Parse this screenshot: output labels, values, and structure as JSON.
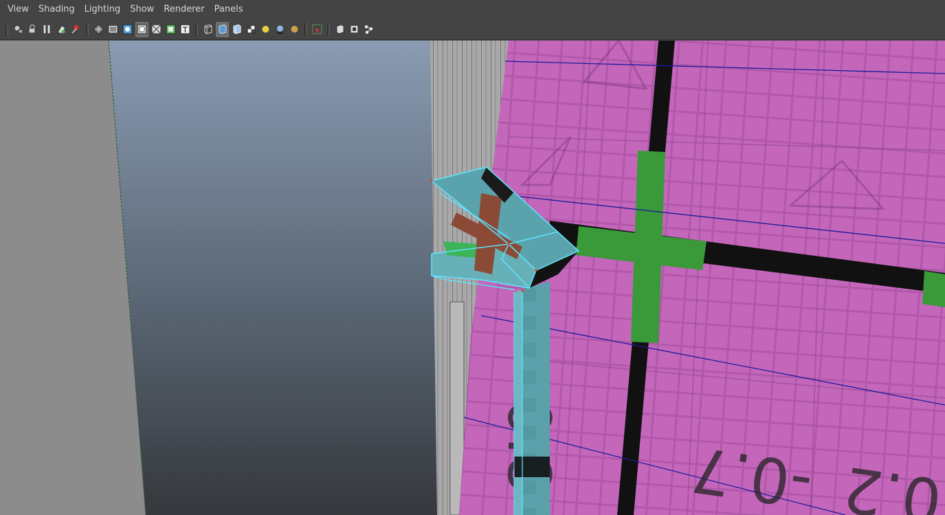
{
  "menu": {
    "items": [
      "View",
      "Shading",
      "Lighting",
      "Show",
      "Renderer",
      "Panels"
    ]
  },
  "toolbar": {
    "groups": [
      [
        {
          "icon": "select-camera-icon"
        },
        {
          "icon": "lock-camera-icon"
        },
        {
          "icon": "camera-attributes-icon"
        },
        {
          "icon": "bookmark-icon"
        },
        {
          "icon": "image-plane-icon"
        }
      ],
      [
        {
          "icon": "grid-icon"
        },
        {
          "icon": "film-gate-icon"
        },
        {
          "icon": "resolution-gate-icon"
        },
        {
          "icon": "gate-mask-icon",
          "active": true
        },
        {
          "icon": "field-chart-icon"
        },
        {
          "icon": "safe-action-icon"
        },
        {
          "icon": "safe-title-icon"
        }
      ],
      [
        {
          "icon": "wireframe-icon"
        },
        {
          "icon": "smooth-shade-icon",
          "active": true
        },
        {
          "icon": "wireframe-on-shaded-icon"
        },
        {
          "icon": "textured-icon"
        },
        {
          "icon": "default-lighting-icon"
        },
        {
          "icon": "shadows-icon"
        },
        {
          "icon": "high-quality-icon"
        }
      ],
      [
        {
          "icon": "isolate-select-icon"
        }
      ],
      [
        {
          "icon": "xray-icon"
        },
        {
          "icon": "xray-joints-icon"
        },
        {
          "icon": "xray-components-icon"
        }
      ]
    ]
  },
  "colors": {
    "ui_bg": "#444444",
    "menu_text": "#d6d6d6",
    "viewport_gray": "#8c8c8c",
    "gradient_top": "#8a9bb2",
    "gradient_bottom": "#35383c",
    "checker_magenta": "#c064b8",
    "selection_cyan": "#5ee3ff",
    "uv_green": "#3a9a3a",
    "mesh_teal": "#5aa3ac"
  },
  "viewport": {
    "uv_labels": [
      "-0.8",
      "-0.7",
      "0.2"
    ]
  }
}
